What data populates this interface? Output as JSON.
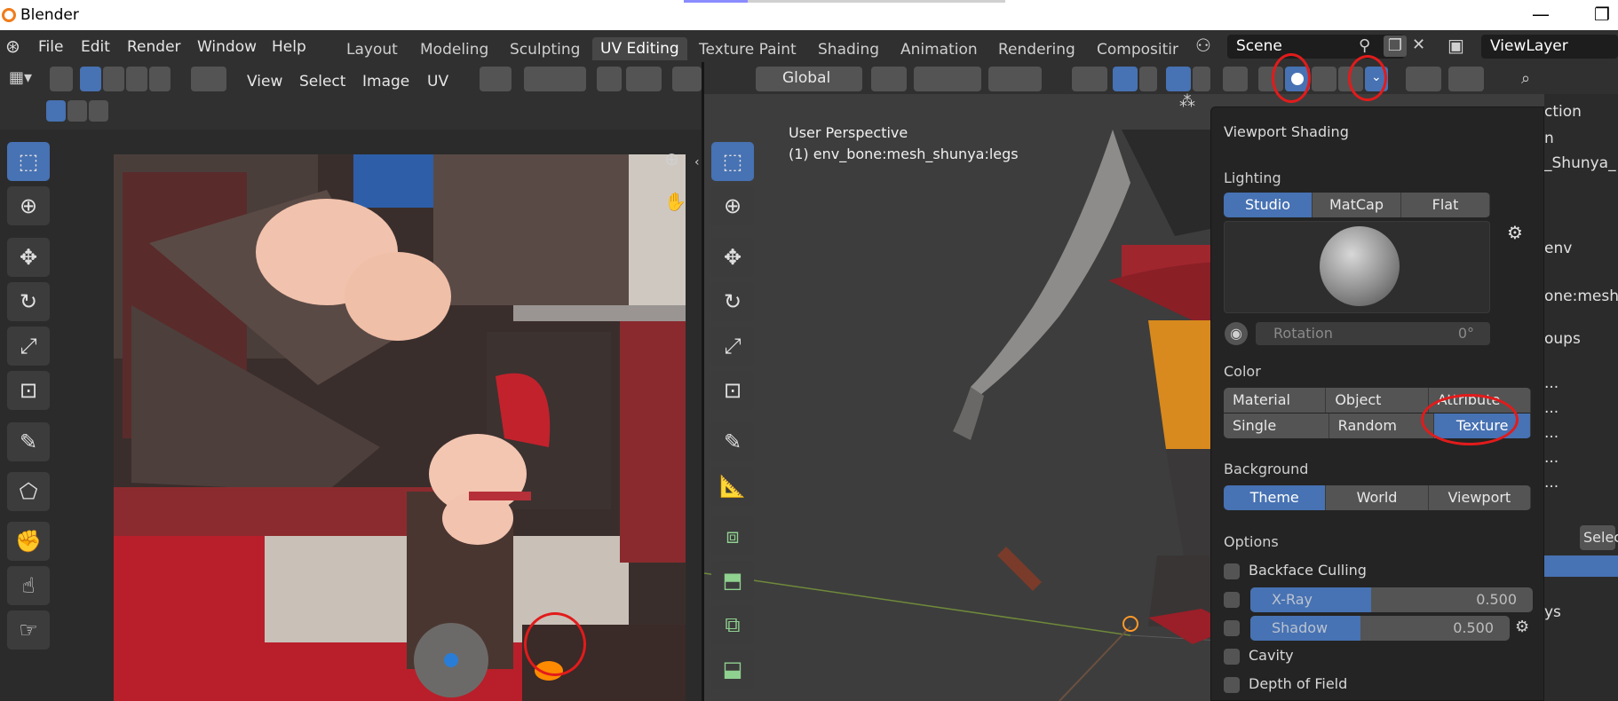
{
  "window": {
    "title": "Blender"
  },
  "menu": [
    "File",
    "Edit",
    "Render",
    "Window",
    "Help"
  ],
  "workspaces": [
    "Layout",
    "Modeling",
    "Sculpting",
    "UV Editing",
    "Texture Paint",
    "Shading",
    "Animation",
    "Rendering",
    "Compositin"
  ],
  "scene_field": "Scene",
  "view_layer_field": "ViewLayer",
  "uv_editor": {
    "menu": [
      "View",
      "Select",
      "Image",
      "UV"
    ],
    "header_label_right": "UV"
  },
  "viewport": {
    "orientation": "Global",
    "overlay_title": "User Perspective",
    "overlay_object": "(1) env_bone:mesh_shunya:legs"
  },
  "shading_popover": {
    "title": "Viewport Shading",
    "lighting_label": "Lighting",
    "lighting_options": [
      "Studio",
      "MatCap",
      "Flat"
    ],
    "lighting_selected": "Studio",
    "rotation_label": "Rotation",
    "rotation_value": "0°",
    "color_label": "Color",
    "color_options_row1": [
      "Material",
      "Object",
      "Attribute"
    ],
    "color_options_row2": [
      "Single",
      "Random",
      "Texture"
    ],
    "color_selected": "Texture",
    "background_label": "Background",
    "background_options": [
      "Theme",
      "World",
      "Viewport"
    ],
    "background_selected": "Theme",
    "options_label": "Options",
    "backface_culling": "Backface Culling",
    "xray_label": "X-Ray",
    "xray_value": "0.500",
    "shadow_label": "Shadow",
    "shadow_value": "0.500",
    "cavity": "Cavity",
    "depth_of_field": "Depth of Field"
  },
  "properties_strip": {
    "line1": "ction",
    "line2": "n",
    "line3": "_Shunya_",
    "line4": "env",
    "line5": "one:mesh_",
    "line6": "oups",
    "dots": "...",
    "select": "Select",
    "line7": "ys"
  },
  "accent_color": "#4772b3"
}
